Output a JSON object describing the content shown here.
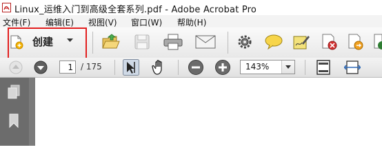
{
  "window": {
    "title": "Linux_运维入门到高级全套系列.pdf - Adobe Acrobat Pro"
  },
  "menu": {
    "items": [
      "文件(F)",
      "编辑(E)",
      "视图(V)",
      "窗口(W)",
      "帮助(H)"
    ]
  },
  "toolbar": {
    "create_label": "创建",
    "icons": [
      "open-folder-icon",
      "save-icon",
      "print-icon",
      "email-icon",
      "gear-icon",
      "comment-icon",
      "sign-icon",
      "redact-icon",
      "export-icon",
      "share-icon"
    ]
  },
  "navigation": {
    "current_page": "1",
    "total_pages": "/ 175",
    "zoom": "143%"
  },
  "colors": {
    "highlight": "#e21d1d",
    "doc_background": "#7b7b7b",
    "left_panel": "#6c6c6c"
  }
}
